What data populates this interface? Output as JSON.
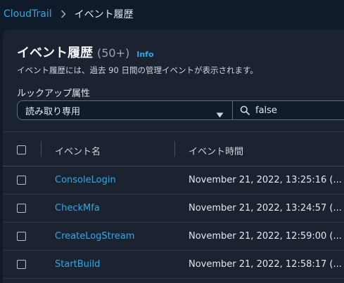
{
  "breadcrumb": {
    "root": "CloudTrail",
    "current": "イベント履歴"
  },
  "panel": {
    "title": "イベント履歴",
    "count": "(50+)",
    "info": "Info",
    "description": "イベント履歴には、過去 90 日間の管理イベントが表示されます。"
  },
  "filter": {
    "label": "ルックアップ属性",
    "attribute_value": "読み取り専用",
    "search_value": "false"
  },
  "table": {
    "columns": [
      "イベント名",
      "イベント時間"
    ],
    "rows": [
      {
        "name": "ConsoleLogin",
        "time": "November 21, 2022, 13:25:16 (..."
      },
      {
        "name": "CheckMfa",
        "time": "November 21, 2022, 13:24:57 (..."
      },
      {
        "name": "CreateLogStream",
        "time": "November 21, 2022, 12:59:00 (..."
      },
      {
        "name": "StartBuild",
        "time": "November 21, 2022, 12:58:17 (..."
      }
    ]
  },
  "colors": {
    "accent": "#2ea8e5",
    "background": "#0f1b2a",
    "panel": "#1b2330"
  },
  "icons": [
    "chevron-right-icon",
    "caret-down-icon",
    "search-icon"
  ]
}
